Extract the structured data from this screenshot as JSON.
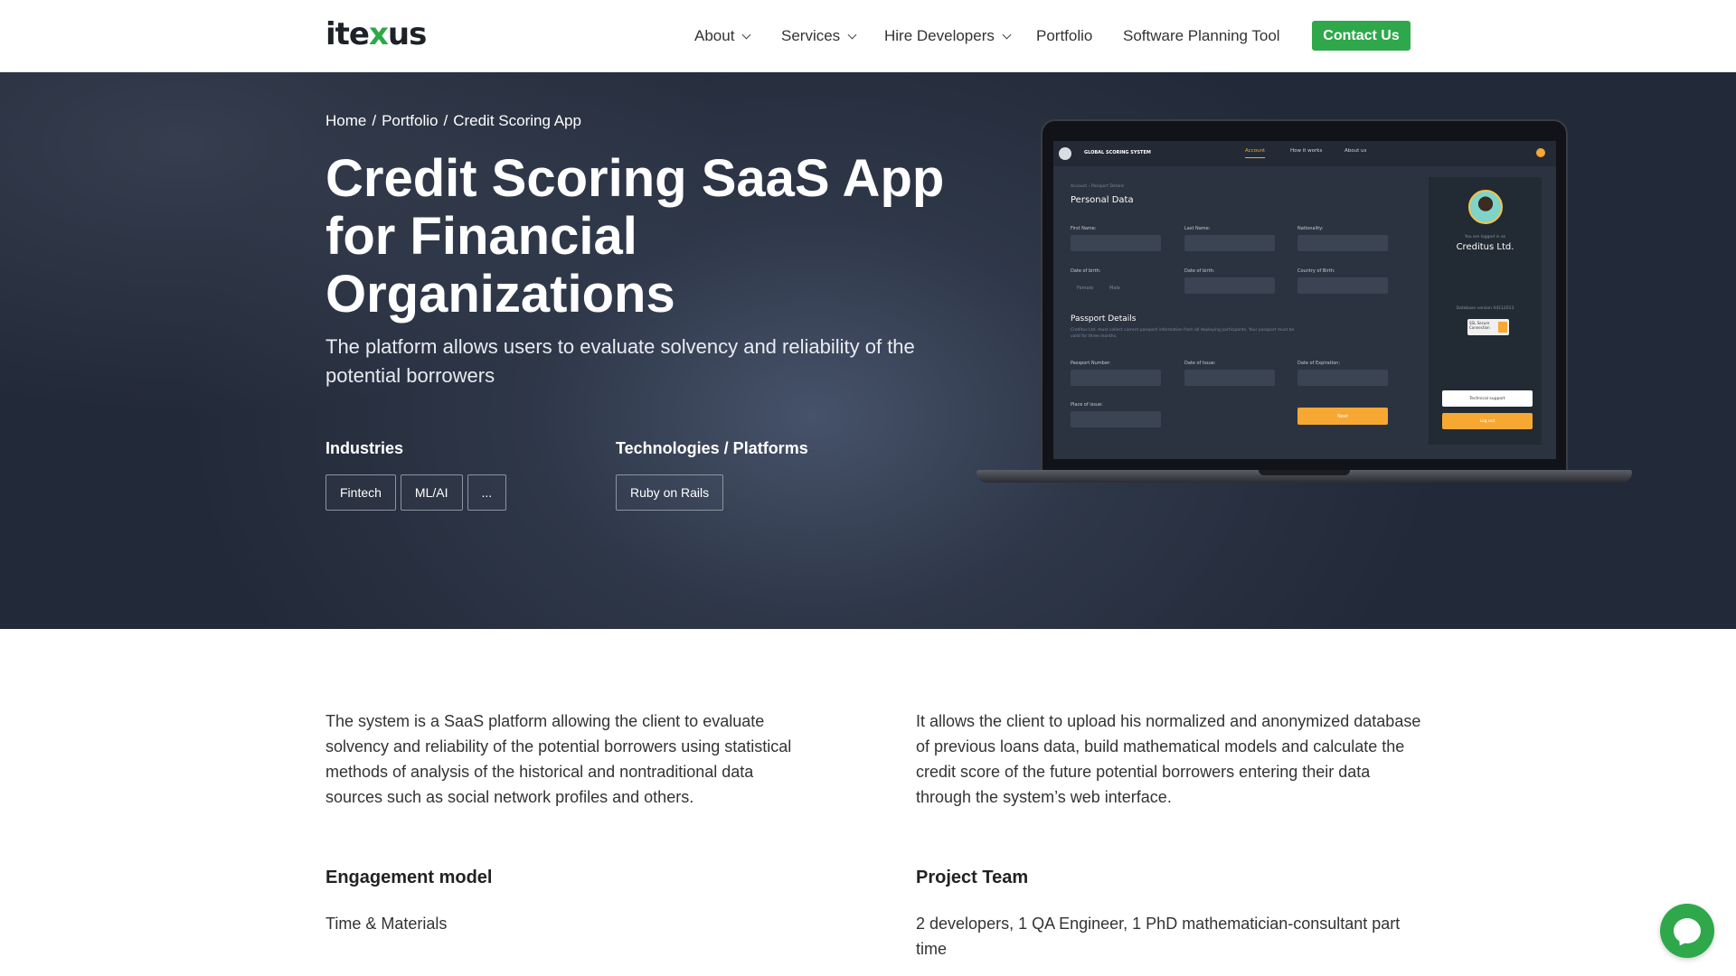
{
  "header": {
    "logo_text": "itexus",
    "nav": [
      {
        "label": "About",
        "has_dropdown": true
      },
      {
        "label": "Services",
        "has_dropdown": true
      },
      {
        "label": "Hire Developers",
        "has_dropdown": true
      },
      {
        "label": "Portfolio",
        "has_dropdown": false
      },
      {
        "label": "Software Planning Tool",
        "has_dropdown": false
      }
    ],
    "contact_label": "Contact Us"
  },
  "hero": {
    "breadcrumb": [
      "Home",
      "/",
      "Portfolio",
      "/",
      "Credit Scoring App"
    ],
    "title": "Credit Scoring SaaS App for Financial Organizations",
    "subtitle": "The platform allows users to evaluate solvency and reliability of the potential borrowers",
    "industries_label": "Industries",
    "industries": [
      "Fintech",
      "ML/AI",
      "..."
    ],
    "tech_label": "Technologies / Platforms",
    "technologies": [
      "Ruby on Rails"
    ]
  },
  "mockup": {
    "brand": "GLOBAL SCORING SYSTEM",
    "nav": [
      "Account",
      "How it works",
      "About us"
    ],
    "crumb": "Account › Passport Details",
    "personal_heading": "Personal Data",
    "labels_row1": [
      "First Name:",
      "Last Name:",
      "Nationality:"
    ],
    "labels_row2": [
      "Date of birth:",
      "Date of birth:",
      "Country of Birth:"
    ],
    "gender": [
      "Female",
      "Male"
    ],
    "passport_heading": "Passport Details",
    "passport_note": "Creditus Ltd. must collect current passport information from all deploying participants. Your passport must be valid for three months.",
    "labels_row3": [
      "Passport Number:",
      "Date of Issue:",
      "Date of Expiration:"
    ],
    "label_place": "Place of issue:",
    "next_label": "Next",
    "logged_in": "You are logged in as",
    "company": "Creditus Ltd.",
    "db_version": "Database version 04112013",
    "ssl": "SSL Secure Connection",
    "tech_support": "Technical support",
    "logout": "Log out"
  },
  "content": {
    "para_left": "The system is a SaaS platform allowing the client to evaluate solvency and reliability of the potential borrowers using statistical methods of analysis of the historical and nontraditional data sources such as social network profiles and others.",
    "para_right": "It allows the client to upload his normalized and anonymized database of previous loans data, build mathematical models and calculate the credit score of the future potential borrowers entering their data through the system’s web interface.",
    "engagement_heading": "Engagement model",
    "engagement_value": "Time & Materials",
    "team_heading": "Project Team",
    "team_value": "2 developers, 1 QA Engineer, 1 PhD mathematician-consultant part time"
  },
  "colors": {
    "accent": "#2ea84a",
    "hero_bg": "#2e3748",
    "mockup_accent": "#f6a833"
  },
  "icons": [
    "chevron-down-icon",
    "chat-icon"
  ]
}
